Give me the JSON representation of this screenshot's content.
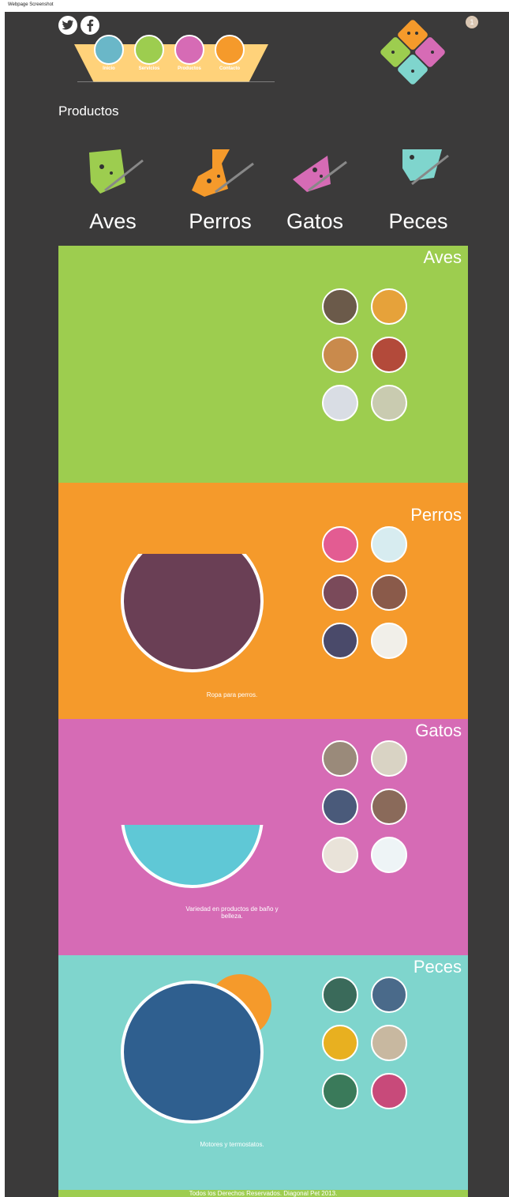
{
  "screenshot_label": "Webpage Screenshot",
  "header": {
    "social": [
      {
        "name": "twitter-icon"
      },
      {
        "name": "facebook-icon"
      }
    ],
    "nav": [
      {
        "label": "Inicio",
        "color": "#6ab7c8"
      },
      {
        "label": "Servicios",
        "color": "#9dcd4f"
      },
      {
        "label": "Productos",
        "color": "#d66bb5"
      },
      {
        "label": "Contacto",
        "color": "#f59a2b"
      }
    ],
    "notification_count": "1"
  },
  "page_title": "Productos",
  "categories": [
    {
      "name": "Aves",
      "color": "#9dcd4f"
    },
    {
      "name": "Perros",
      "color": "#f59a2b"
    },
    {
      "name": "Gatos",
      "color": "#d66bb5"
    },
    {
      "name": "Peces",
      "color": "#7fd5cd"
    }
  ],
  "sections": [
    {
      "title": "Aves",
      "color": "#9dcd4f",
      "caption": ""
    },
    {
      "title": "Perros",
      "color": "#f59a2b",
      "caption": "Ropa para perros."
    },
    {
      "title": "Gatos",
      "color": "#d66bb5",
      "caption": "Variedad en productos de baño y belleza."
    },
    {
      "title": "Peces",
      "color": "#7fd5cd",
      "caption": "Motores y termostatos."
    }
  ],
  "footer": "Todos los Derechos Reservados. Diagonal Pet 2013."
}
